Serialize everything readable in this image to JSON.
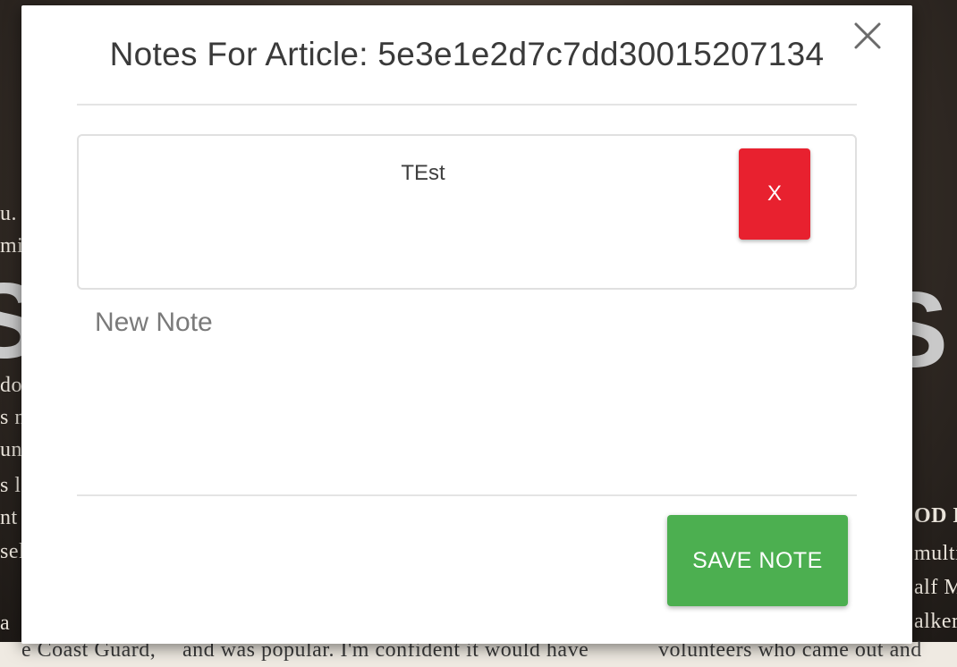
{
  "modal": {
    "title": "Notes For Article: 5e3e1e2d7c7dd30015207134",
    "close_icon": "close-icon"
  },
  "notes": [
    {
      "text": "TEst",
      "delete_label": "X"
    }
  ],
  "new_note": {
    "placeholder": "New Note",
    "value": ""
  },
  "save_button": {
    "label": "SAVE NOTE"
  },
  "colors": {
    "delete": "#e8212f",
    "save": "#4caf50",
    "title": "#3a3a3a"
  }
}
